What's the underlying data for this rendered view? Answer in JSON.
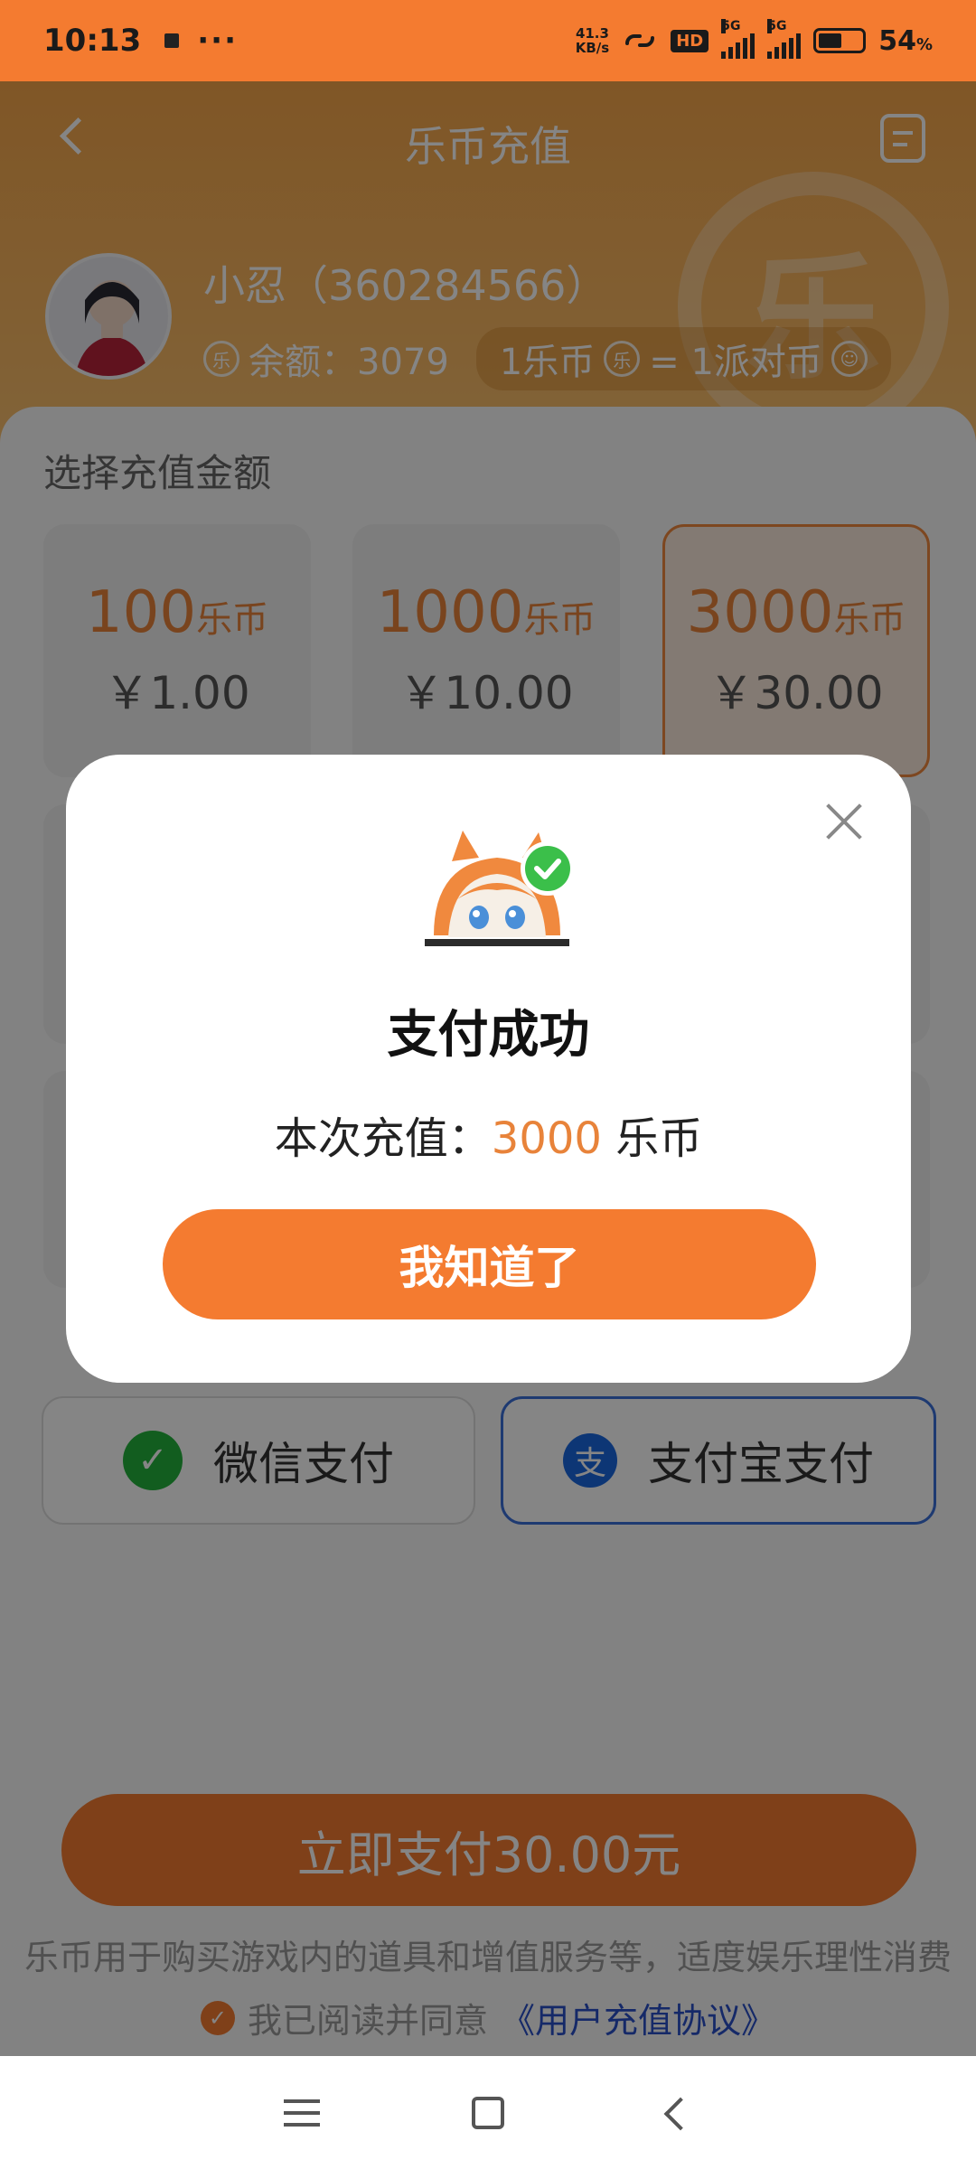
{
  "status_bar": {
    "time": "10:13",
    "dots": "···",
    "net_speed_value": "41.3",
    "net_speed_unit": "KB/s",
    "hd_label": "HD",
    "signal_1_label": "5G",
    "signal_2_label": "5G",
    "battery_percent": "54",
    "battery_unit": "%",
    "battery_level": 0.54
  },
  "header": {
    "title": "乐币充值",
    "coin_glyph": "乐",
    "user_name": "小忍（360284566）",
    "balance_label": "余额：3079",
    "coin_icon_glyph": "乐",
    "rate_left": "1乐币",
    "rate_right": "= 1派对币"
  },
  "recharge": {
    "section_label": "选择充值金额",
    "options": [
      {
        "coins": "100",
        "unit": "乐币",
        "price": "￥1.00"
      },
      {
        "coins": "1000",
        "unit": "乐币",
        "price": "￥10.00"
      },
      {
        "coins": "3000",
        "unit": "乐币",
        "price": "￥30.00",
        "selected": true
      }
    ]
  },
  "payment": {
    "wechat_label": "微信支付",
    "wechat_icon": "wechat-icon",
    "alipay_label": "支付宝支付",
    "alipay_icon_glyph": "支",
    "selected": "alipay"
  },
  "bottom": {
    "pay_button": "立即支付30.00元",
    "disclaimer": "乐币用于购买游戏内的道具和增值服务等，适度娱乐理性消费",
    "agree_prefix": "我已阅读并同意",
    "agree_link": "《用户充值协议》"
  },
  "modal": {
    "title": "支付成功",
    "detail_prefix": "本次充值：",
    "detail_amount": "3000",
    "detail_unit": " 乐币",
    "ok_button": "我知道了"
  },
  "colors": {
    "accent": "#f47b30",
    "coin_text": "#e8833a",
    "link": "#2a4fc8",
    "wechat": "#24b33c",
    "alipay": "#1a68e0"
  }
}
